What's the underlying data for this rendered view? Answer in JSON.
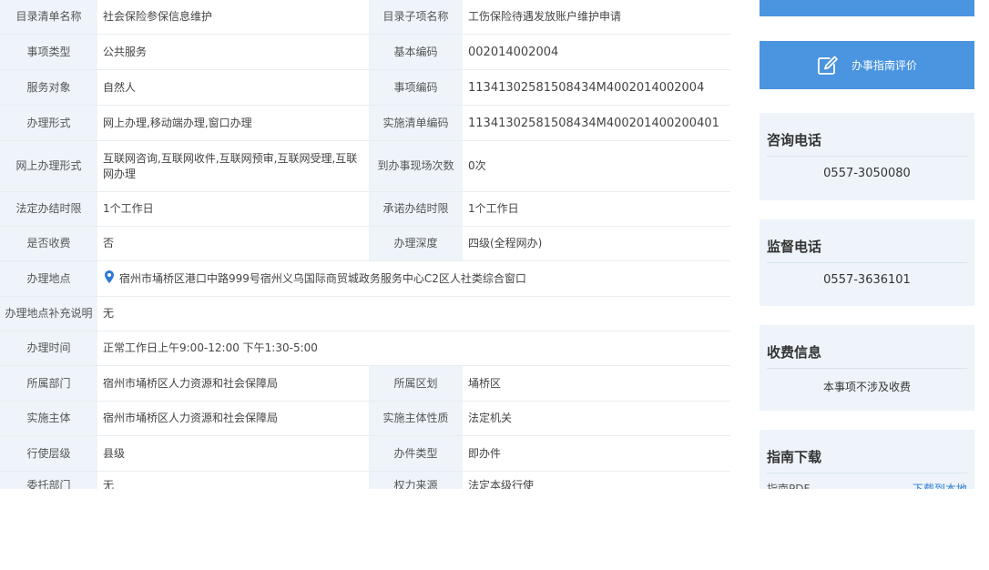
{
  "info_table": {
    "rows": [
      {
        "k1": "目录清单名称",
        "v1": "社会保险参保信息维护",
        "k2": "目录子项名称",
        "v2": "工伤保险待遇发放账户维护申请"
      },
      {
        "k1": "事项类型",
        "v1": "公共服务",
        "k2": "基本编码",
        "v2": "002014002004"
      },
      {
        "k1": "服务对象",
        "v1": "自然人",
        "k2": "事项编码",
        "v2": "11341302581508434M4002014002004"
      },
      {
        "k1": "办理形式",
        "v1": "网上办理,移动端办理,窗口办理",
        "k2": "实施清单编码",
        "v2": "11341302581508434M400201400200401"
      },
      {
        "k1": "网上办理形式",
        "v1": "互联网咨询,互联网收件,互联网预审,互联网受理,互联网办理",
        "k2": "到办事现场次数",
        "v2": "0次"
      },
      {
        "k1": "法定办结时限",
        "v1": "1个工作日",
        "k2": "承诺办结时限",
        "v2": "1个工作日"
      },
      {
        "k1": "是否收费",
        "v1": "否",
        "k2": "办理深度",
        "v2": "四级(全程网办)"
      },
      {
        "k1": "办理地点",
        "v1": "宿州市埇桥区港口中路999号宿州义乌国际商贸城政务服务中心C2区人社类综合窗口"
      },
      {
        "k1": "办理地点补充说明",
        "v1": "无"
      },
      {
        "k1": "办理时间",
        "v1": "正常工作日上午9:00-12:00 下午1:30-5:00"
      },
      {
        "k1": "所属部门",
        "v1": "宿州市埇桥区人力资源和社会保障局",
        "k2": "所属区划",
        "v2": "埇桥区"
      },
      {
        "k1": "实施主体",
        "v1": "宿州市埇桥区人力资源和社会保障局",
        "k2": "实施主体性质",
        "v2": "法定机关"
      },
      {
        "k1": "行使层级",
        "v1": "县级",
        "k2": "办件类型",
        "v2": "即办件"
      },
      {
        "k1": "委托部门",
        "v1": "无",
        "k2": "权力来源",
        "v2": "法定本级行使"
      }
    ]
  },
  "sidebar": {
    "eval_button_label": "办事指南评价",
    "consult": {
      "title": "咨询电话",
      "value": "0557-3050080"
    },
    "supervise": {
      "title": "监督电话",
      "value": "0557-3636101"
    },
    "fee": {
      "title": "收费信息",
      "value": "本事项不涉及收费"
    },
    "download": {
      "title": "指南下载",
      "file_label": "指南PDF",
      "link_label": "下载到本地"
    }
  },
  "colors": {
    "accent": "#4a94e0",
    "key_bg": "#eef4fa",
    "pin": "#2f7bd6"
  },
  "icons": {
    "location": "location-pin-icon",
    "edit": "edit-icon"
  }
}
